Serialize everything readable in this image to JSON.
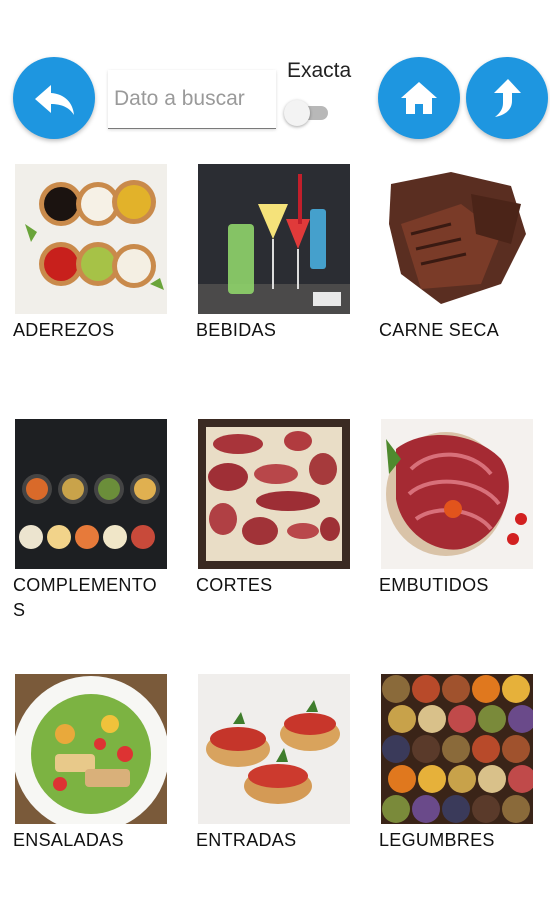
{
  "toolbar": {
    "back_icon": "reply-arrow-icon",
    "home_icon": "home-icon",
    "up_icon": "up-arrow-icon",
    "accent": "#1e96e0"
  },
  "search": {
    "placeholder": "Dato a buscar",
    "value": ""
  },
  "exact_toggle": {
    "label": "Exacta",
    "checked": false
  },
  "categories": [
    {
      "label": "ADEREZOS"
    },
    {
      "label": "BEBIDAS"
    },
    {
      "label": "CARNE SECA"
    },
    {
      "label": "COMPLEMENTOS"
    },
    {
      "label": "CORTES"
    },
    {
      "label": "EMBUTIDOS"
    },
    {
      "label": "ENSALADAS"
    },
    {
      "label": "ENTRADAS"
    },
    {
      "label": "LEGUMBRES"
    }
  ]
}
